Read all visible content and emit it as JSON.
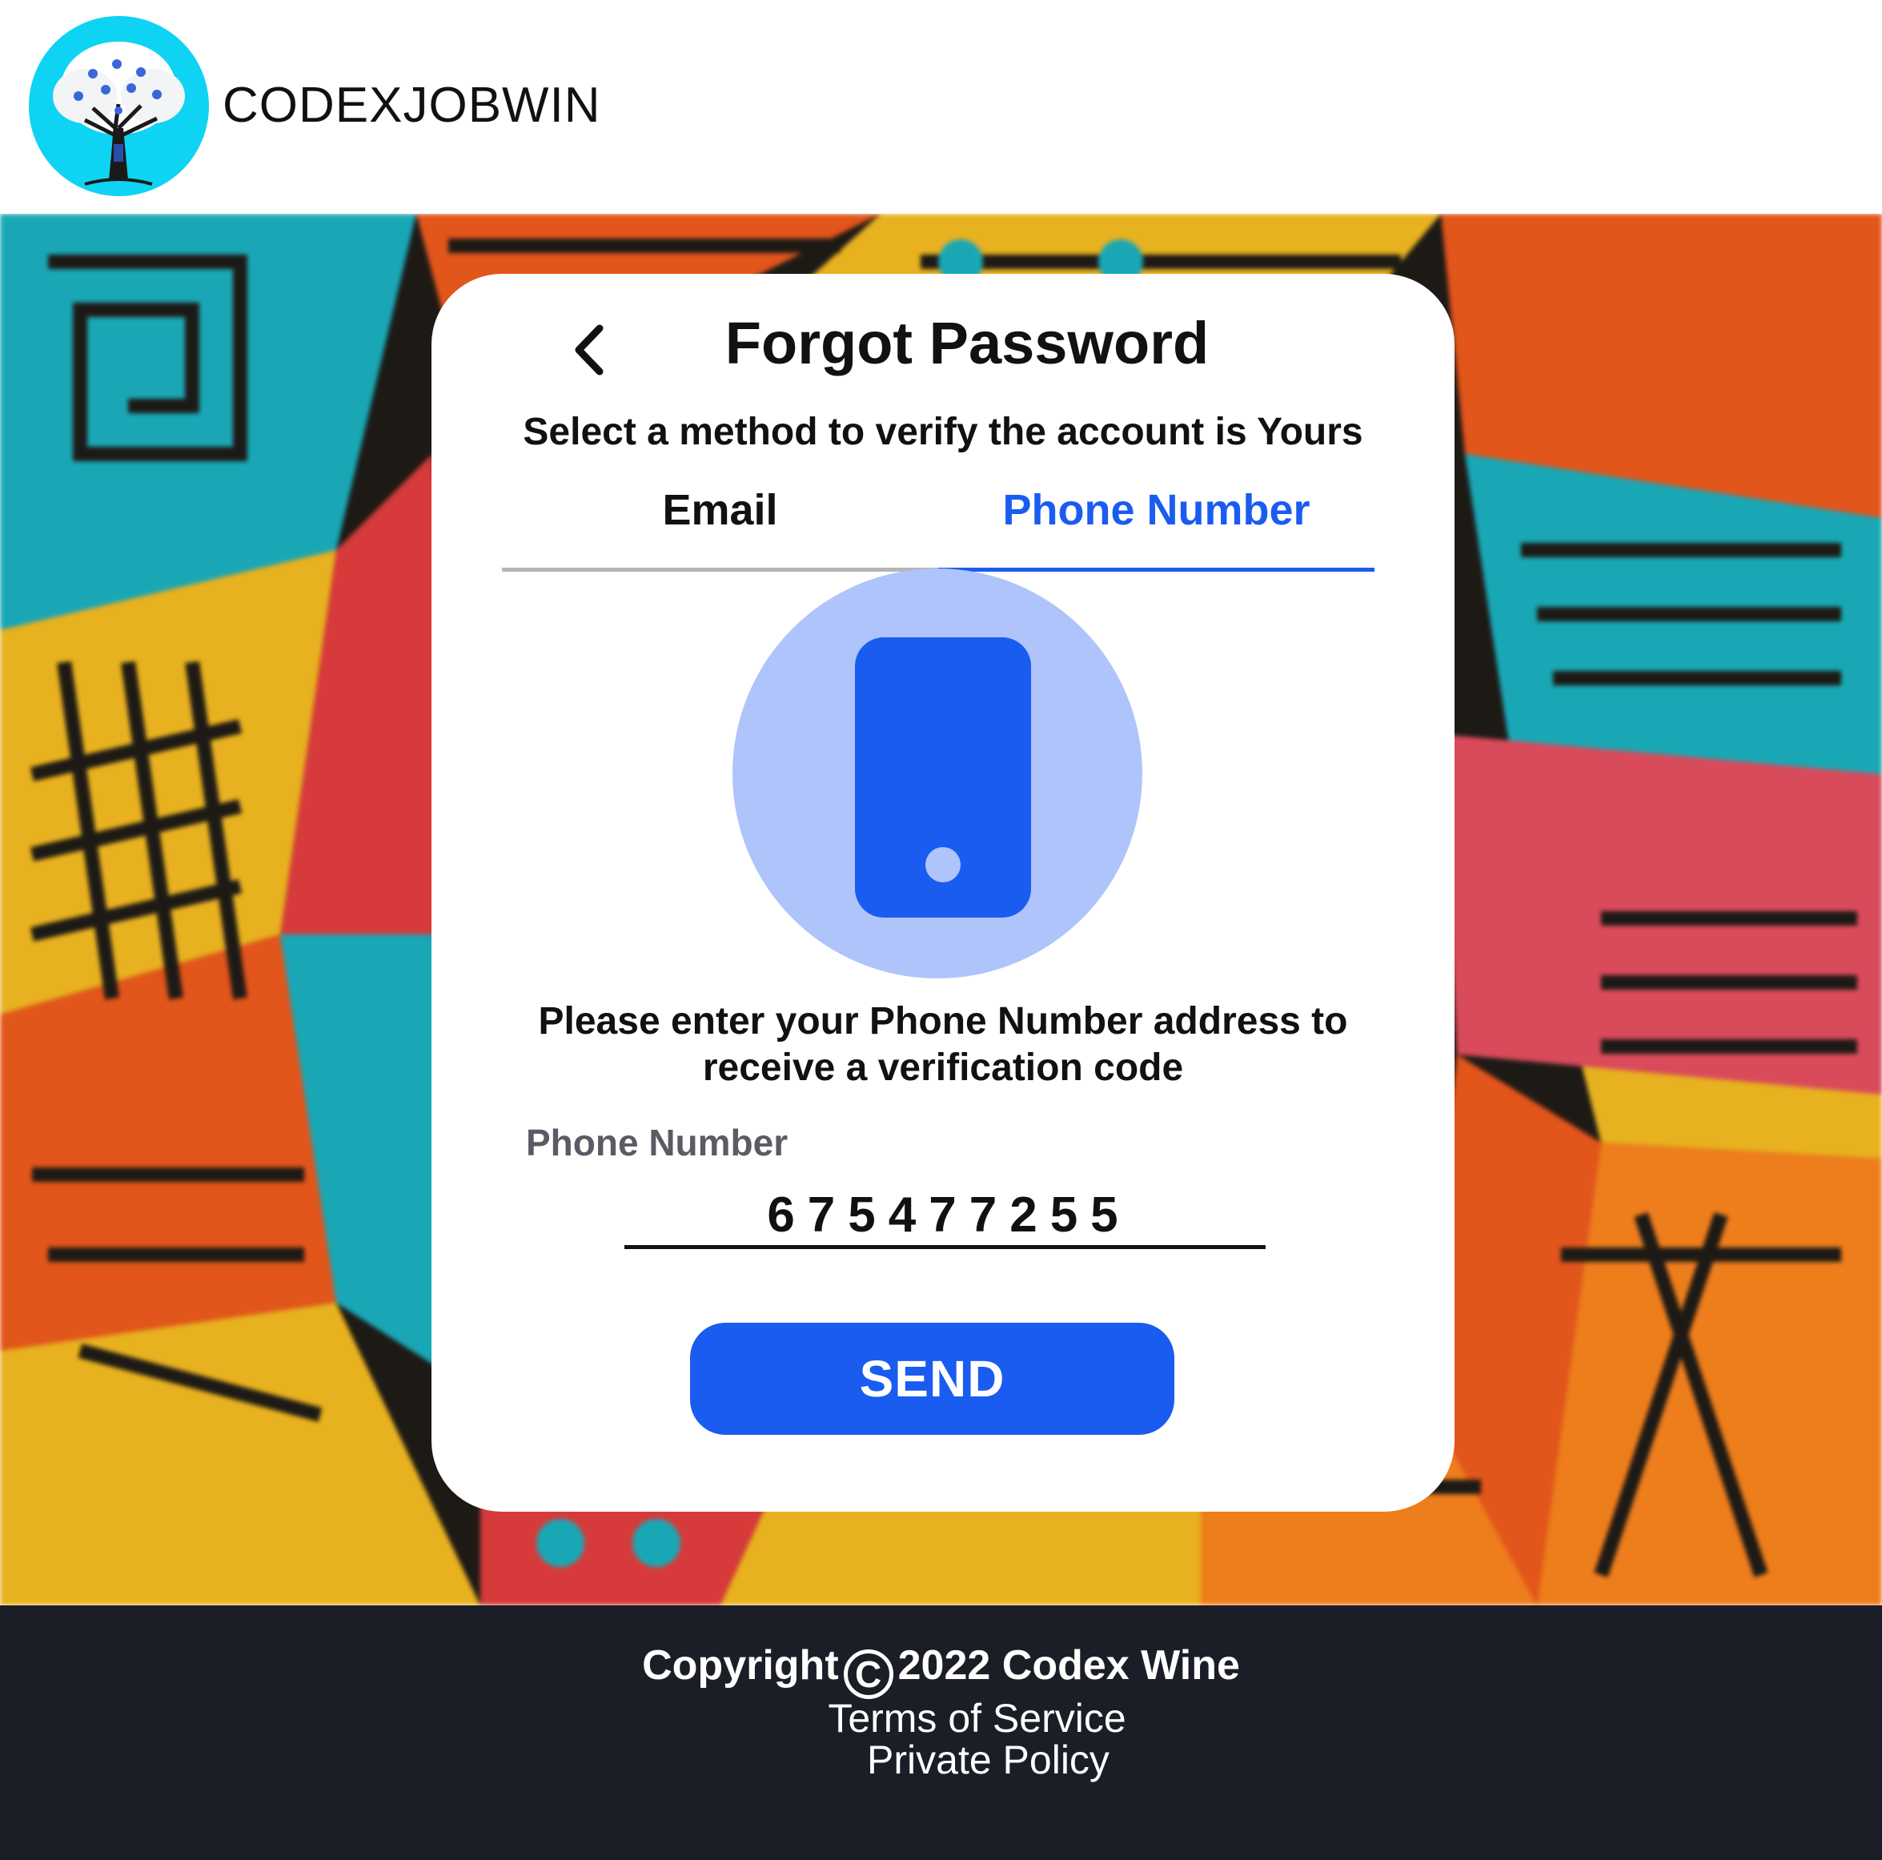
{
  "header": {
    "brand_name": "CODEXJOBWIN",
    "logo_icon": "tree-logo-icon"
  },
  "card": {
    "title": "Forgot Password",
    "back_icon": "chevron-left-icon",
    "subtitle": "Select a method to verify the account is Yours",
    "tabs": [
      {
        "label": "Email",
        "active": false
      },
      {
        "label": "Phone Number",
        "active": true
      }
    ],
    "illustration_icon": "smartphone-icon",
    "instruction": "Please enter your Phone Number address to receive a verification code",
    "phone_field": {
      "label": "Phone Number",
      "value": "675477255"
    },
    "send_label": "SEND"
  },
  "footer": {
    "copyright_prefix": "Copyright",
    "copyright_symbol": "C",
    "copyright_suffix": "2022 Codex Wine",
    "terms_label": "Terms of Service",
    "privacy_label": "Private Policy"
  },
  "colors": {
    "accent": "#1a5cf0",
    "accent_light": "#aec4fb",
    "logo_bg": "#0fd3f3",
    "footer_bg": "#1b1e27"
  }
}
